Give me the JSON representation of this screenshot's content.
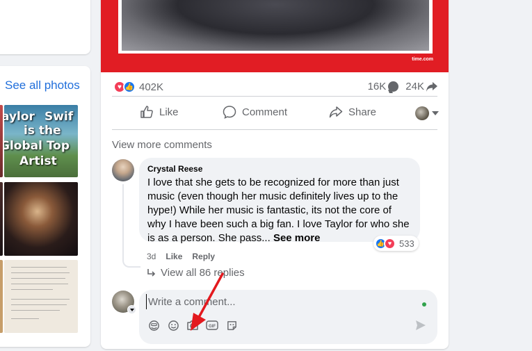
{
  "left": {
    "see_all_photos": "See all photos",
    "thumb1_text": [
      "aylor",
      "Swif",
      "is the",
      "Global Top",
      "Artist"
    ]
  },
  "post": {
    "image_credit": "time.com",
    "reactions_count": "402K",
    "comments_count": "16K",
    "shares_count": "24K",
    "actions": {
      "like": "Like",
      "comment": "Comment",
      "share": "Share"
    },
    "view_more_comments": "View more comments"
  },
  "comment": {
    "author": "Crystal Reese",
    "text": "I love that she gets to be recognized for more than just music (even though her music definitely lives up to the hype!) While her music is fantastic, its not the core of why I have been such a big fan. I love Taylor for who she is as a person. She pass...",
    "see_more": "See more",
    "reaction_count": "533",
    "time": "3d",
    "like": "Like",
    "reply": "Reply",
    "view_replies": "View all 86 replies"
  },
  "composer": {
    "placeholder": "Write a comment..."
  },
  "colors": {
    "accent_blue": "#1877f2",
    "love_red": "#f33e58",
    "online_green": "#31a24c",
    "annotation_red": "#e3191e"
  }
}
